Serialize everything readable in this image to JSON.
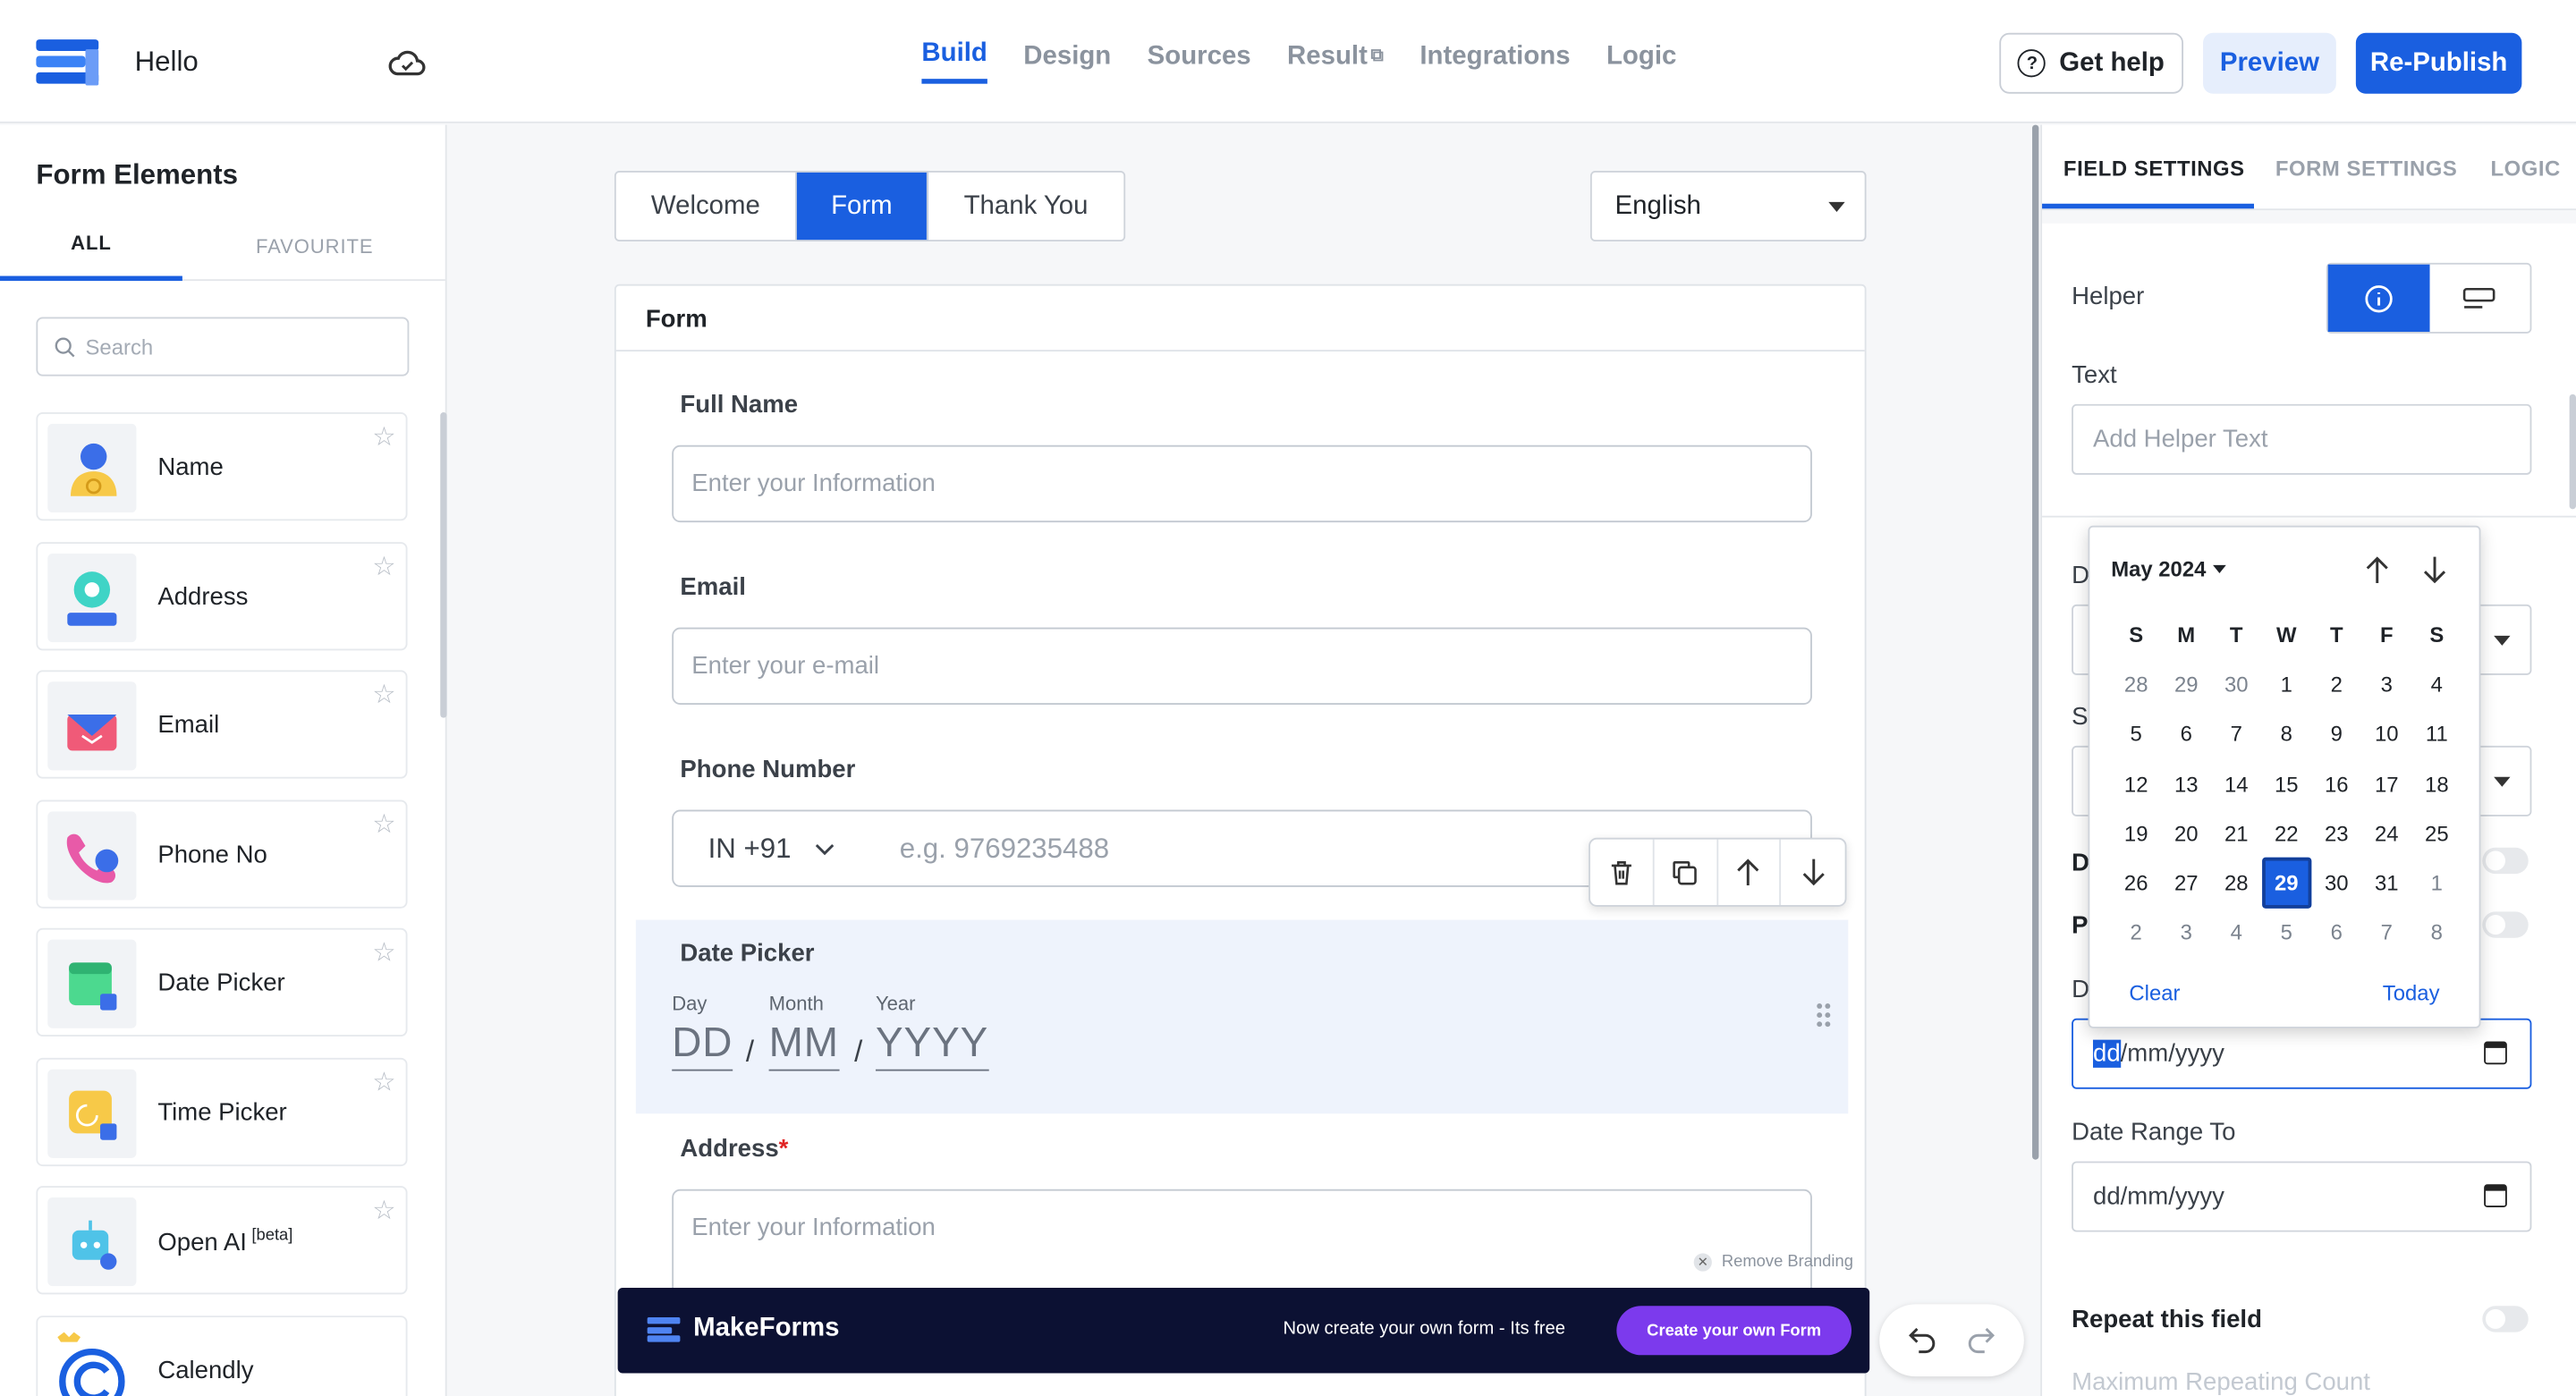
{
  "header": {
    "form_title": "Hello",
    "nav": [
      "Build",
      "Design",
      "Sources",
      "Result",
      "Integrations",
      "Logic"
    ],
    "help_label": "Get help",
    "preview_label": "Preview",
    "publish_label": "Re-Publish",
    "accent_color": "#1a5fe0"
  },
  "left": {
    "title": "Form Elements",
    "tab_all": "ALL",
    "tab_favourite": "FAVOURITE",
    "search_placeholder": "Search",
    "items": [
      {
        "label": "Name",
        "icon": "person-icon"
      },
      {
        "label": "Address",
        "icon": "location-icon"
      },
      {
        "label": "Email",
        "icon": "envelope-icon"
      },
      {
        "label": "Phone No",
        "icon": "phone-icon"
      },
      {
        "label": "Date Picker",
        "icon": "calendar-icon"
      },
      {
        "label": "Time Picker",
        "icon": "clock-icon"
      },
      {
        "label": "Open AI",
        "badge": "[beta]",
        "icon": "robot-icon"
      },
      {
        "label": "Calendly",
        "icon": "calendly-icon"
      }
    ]
  },
  "canvas": {
    "page_tabs": [
      "Welcome",
      "Form",
      "Thank You"
    ],
    "language": "English",
    "card_title": "Form",
    "fields": {
      "full_name_label": "Full Name",
      "full_name_ph": "Enter your Information",
      "email_label": "Email",
      "email_ph": "Enter your e-mail",
      "phone_label": "Phone Number",
      "phone_code": "IN +91",
      "phone_ph": "e.g. 9769235488",
      "date_label": "Date Picker",
      "day_cap": "Day",
      "month_cap": "Month",
      "year_cap": "Year",
      "day_ph": "DD",
      "month_ph": "MM",
      "year_ph": "YYYY",
      "sep": "/",
      "address_label": "Address",
      "address_req": "*",
      "address_ph": "Enter your Information"
    },
    "remove_branding": "Remove Branding",
    "brand_name": "MakeForms",
    "brand_text": "Now create your own form - Its free",
    "brand_cta": "Create your own Form"
  },
  "right": {
    "tabs": [
      "FIELD SETTINGS",
      "FORM SETTINGS",
      "LOGIC"
    ],
    "helper_label": "Helper",
    "text_label": "Text",
    "helper_ph": "Add Helper Text",
    "partial_labels": [
      "D",
      "Se",
      "D",
      "Pl",
      "D"
    ],
    "date_from_value_sel": "dd",
    "date_from_value_rest": "/mm/yyyy",
    "date_to_label": "Date Range To",
    "date_to_value": "dd/mm/yyyy",
    "repeat_label": "Repeat this field",
    "max_repeat_label": "Maximum Repeating Count"
  },
  "calendar": {
    "month": "May 2024",
    "dow": [
      "S",
      "M",
      "T",
      "W",
      "T",
      "F",
      "S"
    ],
    "weeks": [
      [
        "28",
        "29",
        "30",
        "1",
        "2",
        "3",
        "4"
      ],
      [
        "5",
        "6",
        "7",
        "8",
        "9",
        "10",
        "11"
      ],
      [
        "12",
        "13",
        "14",
        "15",
        "16",
        "17",
        "18"
      ],
      [
        "19",
        "20",
        "21",
        "22",
        "23",
        "24",
        "25"
      ],
      [
        "26",
        "27",
        "28",
        "29",
        "30",
        "31",
        "1"
      ],
      [
        "2",
        "3",
        "4",
        "5",
        "6",
        "7",
        "8"
      ]
    ],
    "selected": "29",
    "clear": "Clear",
    "today": "Today"
  }
}
